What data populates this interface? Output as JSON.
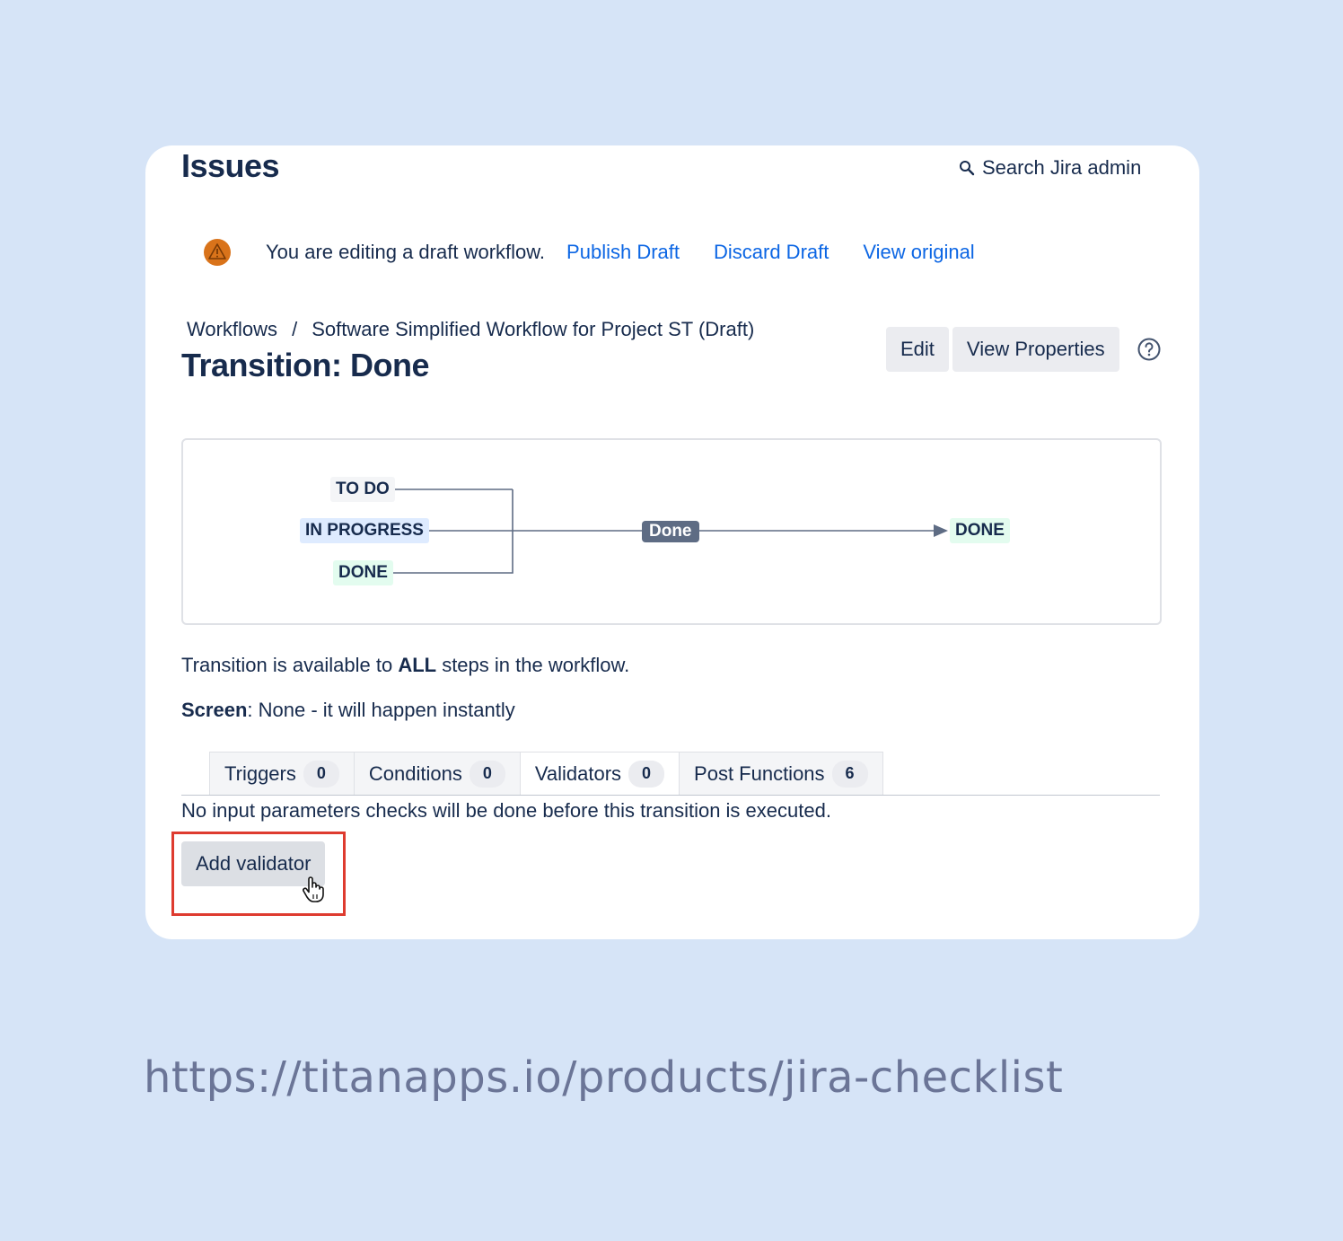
{
  "header": {
    "title": "Issues",
    "search_label": "Search Jira admin"
  },
  "banner": {
    "message": "You are editing a draft workflow.",
    "links": [
      "Publish Draft",
      "Discard Draft",
      "View original"
    ]
  },
  "breadcrumb": {
    "items": [
      "Workflows",
      "Software Simplified Workflow for Project ST (Draft)"
    ],
    "separator": "/"
  },
  "page": {
    "title": "Transition: Done"
  },
  "actions": {
    "edit_label": "Edit",
    "properties_label": "View Properties"
  },
  "diagram": {
    "from_statuses": [
      "TO DO",
      "IN PROGRESS",
      "DONE"
    ],
    "transition_label": "Done",
    "to_status": "DONE"
  },
  "info": {
    "availability_prefix": "Transition is available to ",
    "availability_bold": "ALL",
    "availability_suffix": " steps in the workflow.",
    "screen_label": "Screen",
    "screen_value": ": None - it will happen instantly"
  },
  "tabs": [
    {
      "label": "Triggers",
      "count": "0"
    },
    {
      "label": "Conditions",
      "count": "0"
    },
    {
      "label": "Validators",
      "count": "0",
      "active": true
    },
    {
      "label": "Post Functions",
      "count": "6"
    }
  ],
  "validators": {
    "description": "No input parameters checks will be done before this transition is executed.",
    "add_button": "Add validator"
  },
  "footer": {
    "url": "https://titanapps.io/products/jira-checklist"
  },
  "colors": {
    "background": "#d6e4f7",
    "link": "#0c66e4",
    "highlight": "#de3b2f",
    "warning": "#d9731a"
  }
}
